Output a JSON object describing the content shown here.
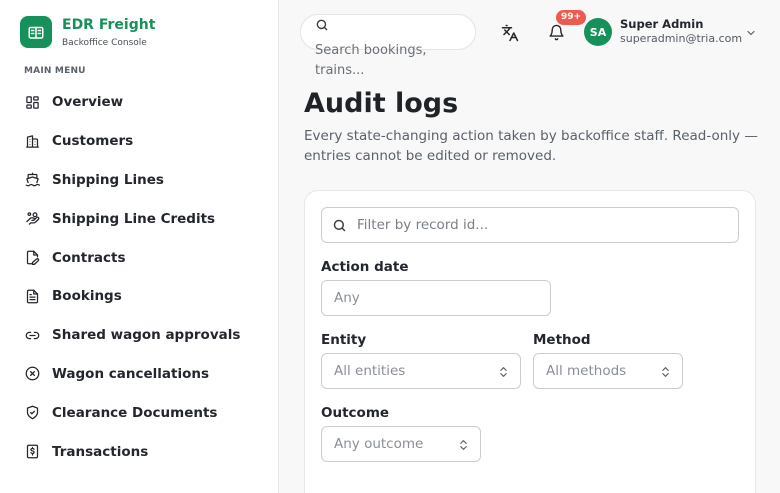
{
  "brand": {
    "name": "EDR Freight",
    "subtitle": "Backoffice Console"
  },
  "sidebar": {
    "heading": "MAIN MENU",
    "items": [
      {
        "label": "Overview",
        "icon": "grid-icon"
      },
      {
        "label": "Customers",
        "icon": "building-icon"
      },
      {
        "label": "Shipping Lines",
        "icon": "ship-icon"
      },
      {
        "label": "Shipping Line Credits",
        "icon": "hand-coins-icon"
      },
      {
        "label": "Contracts",
        "icon": "file-pen-icon"
      },
      {
        "label": "Bookings",
        "icon": "file-text-icon"
      },
      {
        "label": "Shared wagon approvals",
        "icon": "link-icon"
      },
      {
        "label": "Wagon cancellations",
        "icon": "x-circle-icon"
      },
      {
        "label": "Clearance Documents",
        "icon": "shield-check-icon"
      },
      {
        "label": "Transactions",
        "icon": "receipt-dollar-icon"
      }
    ]
  },
  "header": {
    "search_placeholder": "Search bookings, trains...",
    "notification_badge": "99+",
    "user": {
      "initials": "SA",
      "name": "Super Admin",
      "email": "superadmin@tria.com"
    }
  },
  "main": {
    "title": "Audit logs",
    "description": "Every state-changing action taken by backoffice staff. Read-only — entries cannot be edited or removed.",
    "filters": {
      "record_placeholder": "Filter by record id...",
      "action_date_label": "Action date",
      "action_date_placeholder": "Any",
      "entity_label": "Entity",
      "entity_value": "All entities",
      "method_label": "Method",
      "method_value": "All methods",
      "outcome_label": "Outcome",
      "outcome_value": "Any outcome"
    }
  },
  "colors": {
    "brand": "#17915a",
    "badge": "#ef5a4f",
    "text": "#23272d",
    "muted": "#5b616b"
  }
}
